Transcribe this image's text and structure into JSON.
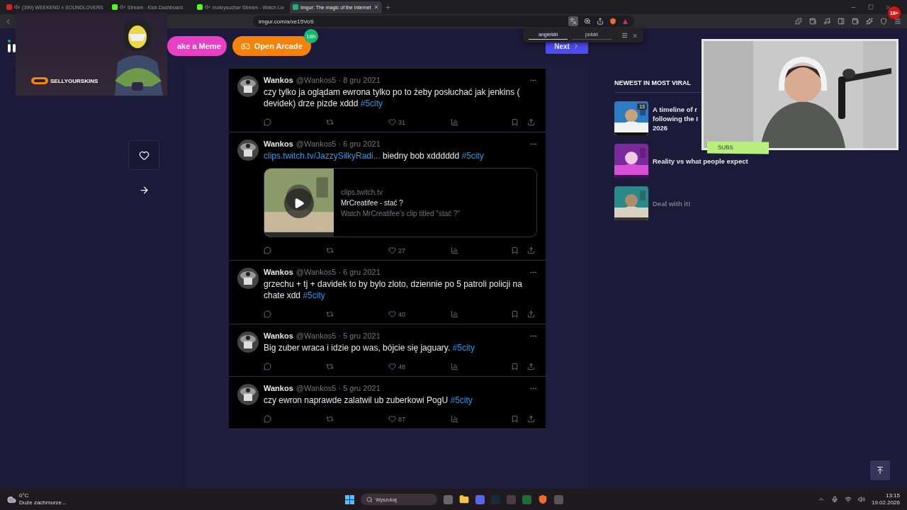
{
  "browser": {
    "tabs": [
      {
        "title": "(399) WEEKEND x SOUNDLOVERS",
        "muted": false,
        "selected": false
      },
      {
        "title": "Stream - Kick Dashboard",
        "muted": true,
        "selected": false
      },
      {
        "title": "mokrysuchar Stream - Watch Liv",
        "muted": true,
        "selected": false
      },
      {
        "title": "Imgur: The magic of the Internet",
        "selected": true
      }
    ],
    "url": "imgur.com/a/xe15VoS",
    "translate_popup": {
      "languages": [
        {
          "label": "angielski",
          "selected": true
        },
        {
          "label": "polski",
          "selected": false
        }
      ]
    }
  },
  "header": {
    "buttons": [
      {
        "kind": "meme",
        "label": "ake a Meme"
      },
      {
        "kind": "arcade",
        "label": "Open Arcade",
        "badge": "18h"
      }
    ],
    "next": "Next"
  },
  "tweets": [
    {
      "author": "Wankos",
      "handle": "@Wankos5 · 8 gru 2021",
      "parts": [
        {
          "kind": "text",
          "text": "czy tylko ja oglądam ewrona tylko po to żeby posłuchać jak jenkins ( devidek) drze pizde xddd "
        },
        {
          "kind": "tag",
          "text": "#5city"
        }
      ],
      "likes": "31"
    },
    {
      "author": "Wankos",
      "handle": "@Wankos5 · 6 gru 2021",
      "parts": [
        {
          "kind": "link",
          "text": "clips.twitch.tv/JazzySilkyRadi..."
        },
        {
          "kind": "text",
          "text": " biedny bob xdddddd "
        },
        {
          "kind": "tag",
          "text": "#5city"
        }
      ],
      "card": {
        "domain": "clips.twitch.tv",
        "title": "MrCreatifee - stać ?",
        "description": "Watch MrCreatifee's clip titled \"stać ?\""
      },
      "likes": "27"
    },
    {
      "author": "Wankos",
      "handle": "@Wankos5 · 6 gru 2021",
      "parts": [
        {
          "kind": "text",
          "text": "grzechu + tj + davidek to by bylo zloto, dziennie po 5 patroli policji na chate xdd "
        },
        {
          "kind": "tag",
          "text": "#5city"
        }
      ],
      "likes": "40"
    },
    {
      "author": "Wankos",
      "handle": "@Wankos5 · 5 gru 2021",
      "parts": [
        {
          "kind": "text",
          "text": "Big zuber wraca i idzie po was, bójcie się jaguary. "
        },
        {
          "kind": "tag",
          "text": "#5city"
        }
      ],
      "likes": "48"
    },
    {
      "author": "Wankos",
      "handle": "@Wankos5 · 5 gru 2021",
      "parts": [
        {
          "kind": "text",
          "text": "czy ewron naprawde zalatwil ub zuberkowi PogU "
        },
        {
          "kind": "tag",
          "text": "#5city"
        }
      ],
      "likes": "87"
    }
  ],
  "sidebar": {
    "title": "NEWEST IN MOST VIRAL",
    "posts": [
      {
        "lines": [
          "A timeline of r",
          "following the I",
          "2026"
        ],
        "badge": "13",
        "dimmed": false
      },
      {
        "lines": [
          "Reality vs what people expect"
        ],
        "dimmed": false
      },
      {
        "lines": [
          "Deal with it!"
        ],
        "dimmed": true
      }
    ]
  },
  "stream_overlay": {
    "sponsor": "SELLYOURSKINS",
    "webcam_label": "SUBS",
    "age_badge": "18+"
  },
  "taskbar": {
    "temperature": "0°C",
    "weather": "Duże zachmurze...",
    "search_placeholder": "Wyszukaj",
    "time": "13:15",
    "date": "19.02.2026"
  }
}
